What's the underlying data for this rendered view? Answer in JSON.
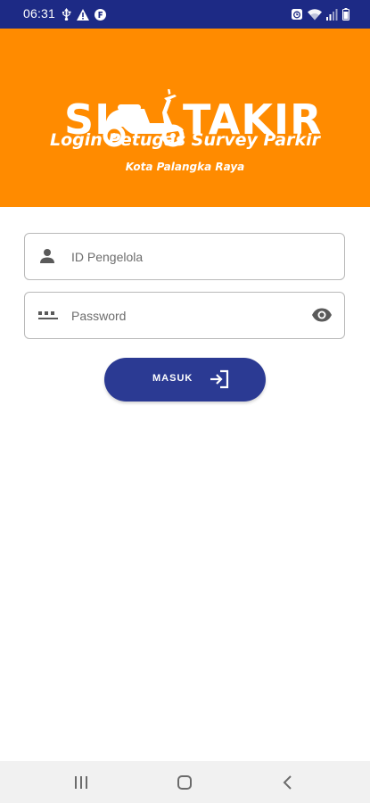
{
  "status_bar": {
    "time": "06:31",
    "left_icons": [
      "usb-icon",
      "warning-icon",
      "f-app-icon"
    ],
    "right_icons": [
      "alarm-icon",
      "wifi-icon",
      "signal-icon",
      "battery-icon"
    ]
  },
  "header": {
    "logo_left": "SI",
    "logo_right": "TAKIR",
    "title": "Login Petugas Survey Parkir",
    "subtitle": "Kota Palangka Raya",
    "background_color": "#ff8b00"
  },
  "form": {
    "id_field": {
      "placeholder": "ID Pengelola",
      "value": "",
      "icon": "person-icon"
    },
    "password_field": {
      "placeholder": "Password",
      "value": "",
      "icon": "password-dots-icon",
      "toggle_icon": "eye-icon"
    },
    "submit": {
      "label": "MASUK",
      "icon": "login-icon",
      "color": "#2b3a93"
    }
  },
  "nav_bar": {
    "buttons": [
      "recent-apps-icon",
      "home-icon",
      "back-icon"
    ]
  },
  "colors": {
    "status_bar": "#1d2a85",
    "accent": "#ff8b00",
    "primary": "#2b3a93"
  }
}
